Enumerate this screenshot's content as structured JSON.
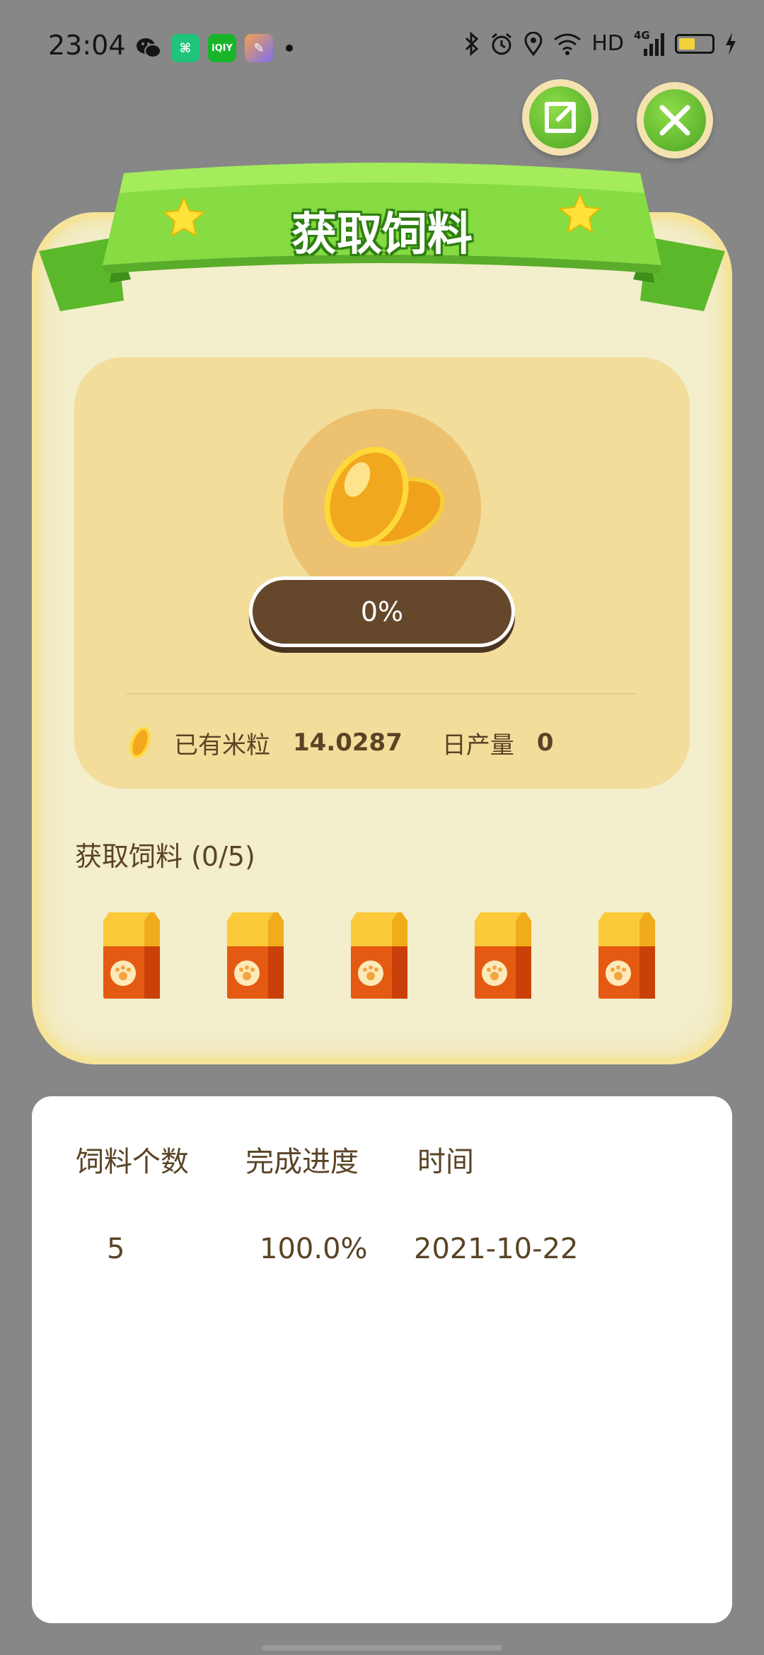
{
  "status_bar": {
    "time": "23:04",
    "network_label": "HD",
    "signal_label": "4G",
    "left_icons": [
      "wechat-icon",
      "app-icon-green",
      "iqiyi-icon",
      "app-icon-gradient"
    ],
    "right_icons": [
      "bluetooth-icon",
      "alarm-icon",
      "location-icon",
      "wifi-icon",
      "signal-icon",
      "battery-icon",
      "charging-icon"
    ],
    "iqiyi_text": "iQIY"
  },
  "header": {
    "title": "获取饲料",
    "share_icon": "share-icon",
    "close_icon": "close-icon"
  },
  "progress": {
    "label": "0%",
    "value": 0
  },
  "stats": {
    "rice_label": "已有米粒",
    "rice_value": "14.0287",
    "daily_label": "日产量",
    "daily_value": "0"
  },
  "feed": {
    "title": "获取饲料 (0/5)",
    "bags": 5
  },
  "table": {
    "headers": [
      "饲料个数",
      "完成进度",
      "时间"
    ],
    "rows": [
      [
        "5",
        "100.0%",
        "2021-10-22"
      ]
    ]
  },
  "colors": {
    "accent_green": "#5fbe2c",
    "brown": "#65482c",
    "card_bg": "#f3eecb",
    "panel_bg": "#f3dd9b"
  }
}
